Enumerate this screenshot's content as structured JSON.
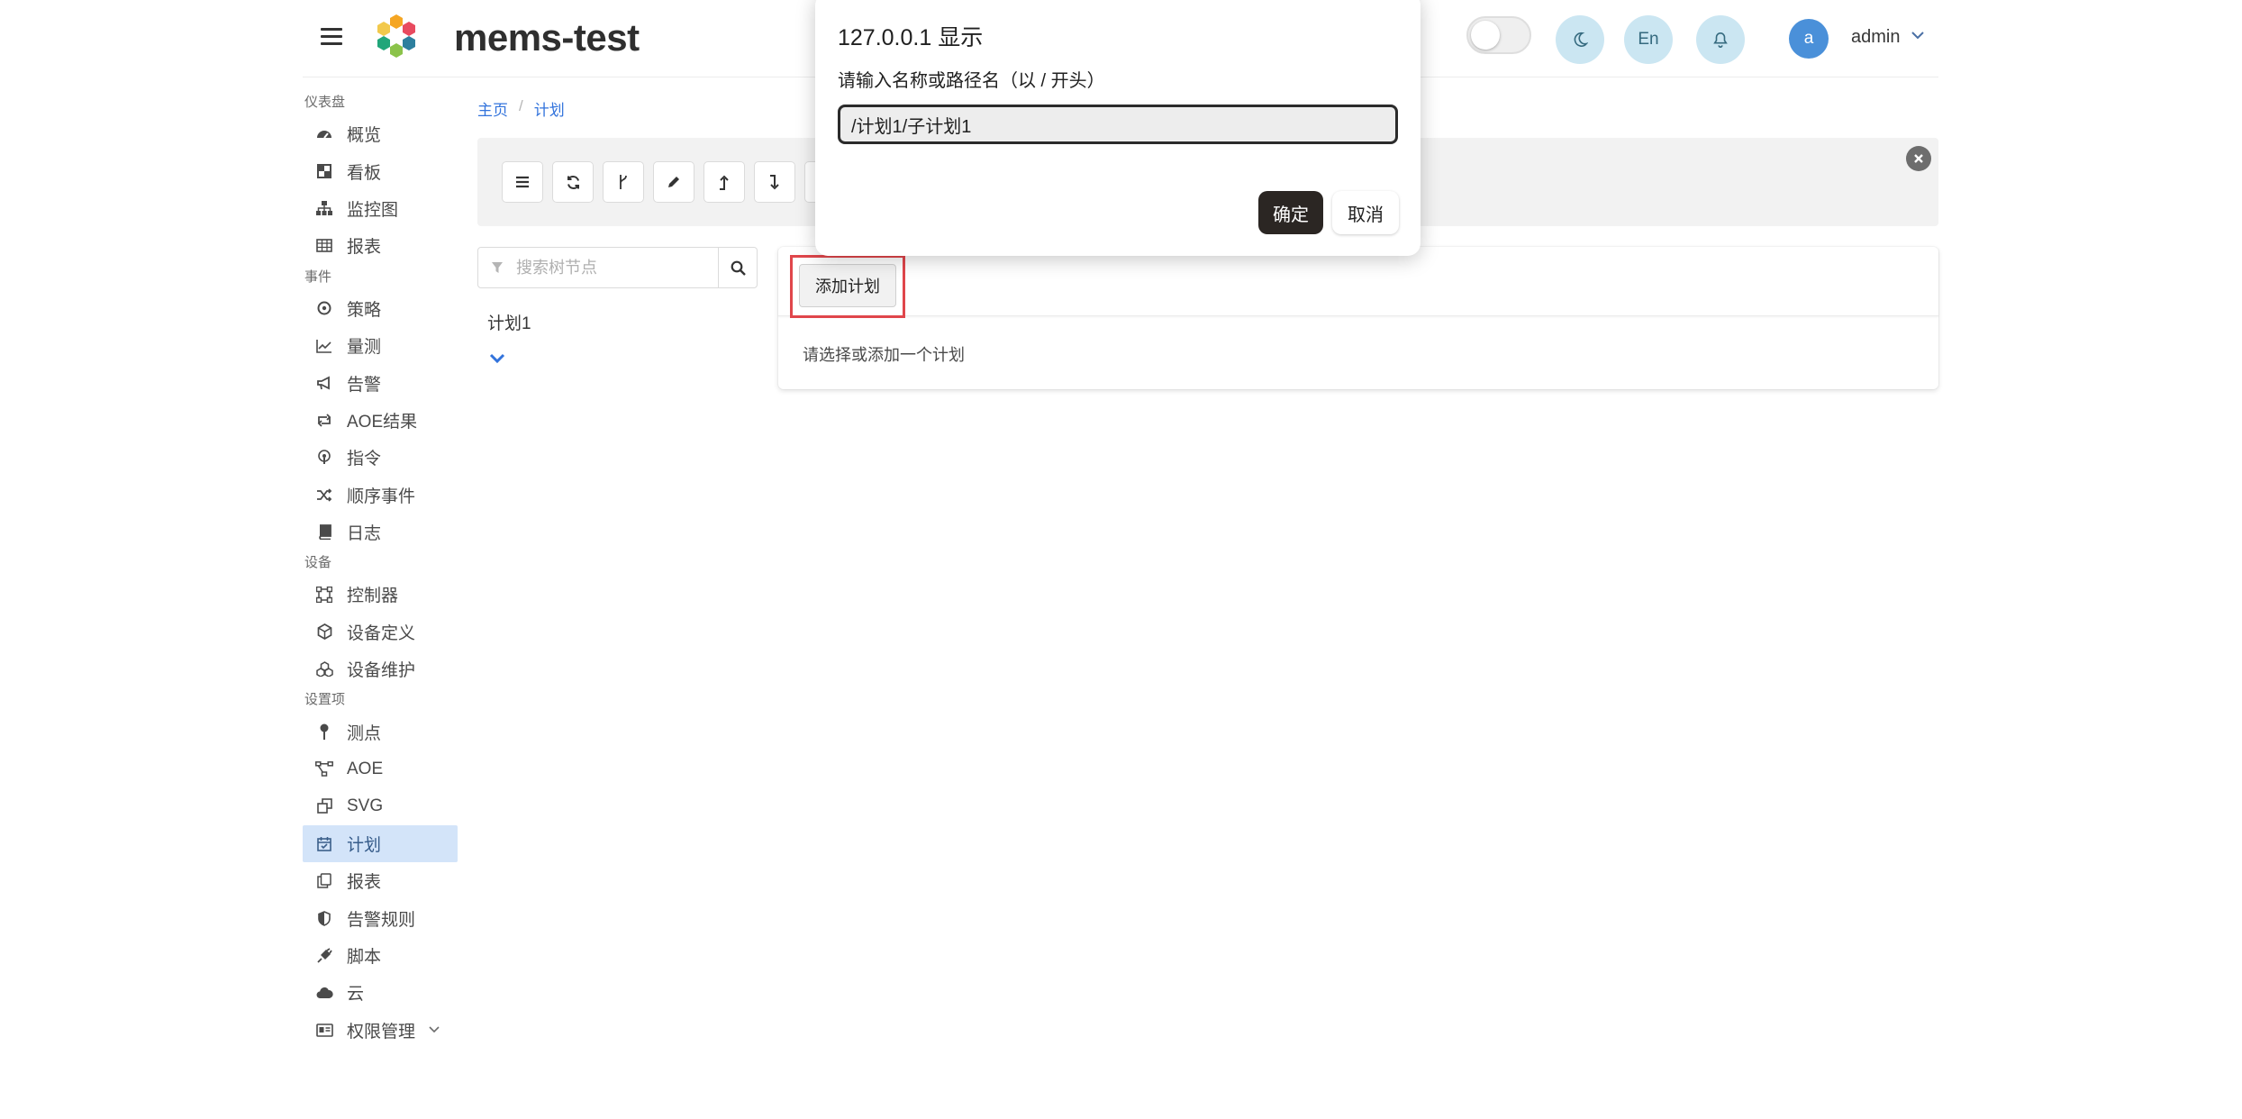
{
  "header": {
    "app_title": "mems-test",
    "lang_button": "En",
    "user_avatar_letter": "a",
    "user_name": "admin"
  },
  "sidebar": {
    "sections": [
      {
        "label": "仪表盘",
        "items": [
          {
            "label": "概览",
            "icon": "tachometer-icon"
          },
          {
            "label": "看板",
            "icon": "dashboard-grid-icon"
          },
          {
            "label": "监控图",
            "icon": "sitemap-icon"
          },
          {
            "label": "报表",
            "icon": "table-icon"
          }
        ]
      },
      {
        "label": "事件",
        "items": [
          {
            "label": "策略",
            "icon": "compass-icon"
          },
          {
            "label": "量测",
            "icon": "line-chart-icon"
          },
          {
            "label": "告警",
            "icon": "bullhorn-icon"
          },
          {
            "label": "AOE结果",
            "icon": "retweet-icon"
          },
          {
            "label": "指令",
            "icon": "podcast-icon"
          },
          {
            "label": "顺序事件",
            "icon": "shuffle-icon"
          },
          {
            "label": "日志",
            "icon": "book-icon"
          }
        ]
      },
      {
        "label": "设备",
        "items": [
          {
            "label": "控制器",
            "icon": "vector-square-icon"
          },
          {
            "label": "设备定义",
            "icon": "cube-icon"
          },
          {
            "label": "设备维护",
            "icon": "cubes-icon"
          }
        ]
      },
      {
        "label": "设置项",
        "items": [
          {
            "label": "测点",
            "icon": "map-pin-icon"
          },
          {
            "label": "AOE",
            "icon": "project-diagram-icon"
          },
          {
            "label": "SVG",
            "icon": "clone-icon"
          },
          {
            "label": "计划",
            "icon": "calendar-check-icon",
            "active": true
          },
          {
            "label": "报表",
            "icon": "copy-icon"
          },
          {
            "label": "告警规则",
            "icon": "shield-icon"
          },
          {
            "label": "脚本",
            "icon": "plug-icon"
          },
          {
            "label": "云",
            "icon": "cloud-icon"
          },
          {
            "label": "权限管理",
            "icon": "id-card-icon",
            "expandable": true
          }
        ]
      }
    ]
  },
  "breadcrumb": {
    "home": "主页",
    "current": "计划"
  },
  "tree": {
    "search_placeholder": "搜索树节点",
    "nodes": [
      "计划1"
    ]
  },
  "card": {
    "add_button": "添加计划",
    "empty_text": "请选择或添加一个计划"
  },
  "dialog": {
    "title": "127.0.0.1 显示",
    "message": "请输入名称或路径名（以 / 开头）",
    "input_value": "/计划1/子计划1",
    "ok_label": "确定",
    "cancel_label": "取消"
  },
  "colors": {
    "accent_link": "#3273dc",
    "active_menu_bg": "#d3e4f9",
    "highlight_box": "#e0464b",
    "header_circle_bg": "#cbe6f2",
    "avatar_bg": "#4a90d9"
  }
}
